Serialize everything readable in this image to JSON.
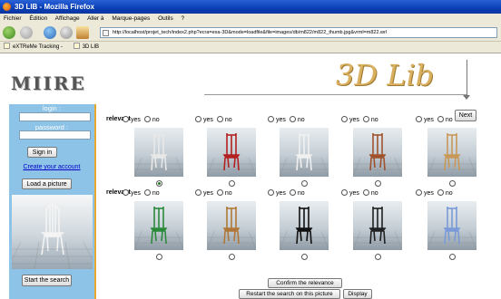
{
  "window": {
    "title": "3D LIB - Mozilla Firefox"
  },
  "menu": [
    "Fichier",
    "Édition",
    "Affichage",
    "Aller à",
    "Marque-pages",
    "Outils",
    "?"
  ],
  "address": {
    "url": "http://localhost/projet_tech/index2.php?ecra=exa-3D&mode=loadfile&file=images/db/m822/m822_thumb.jpg&vrml=m822.wrl"
  },
  "bookmarks": [
    "eXTReMe Tracking -",
    "3D LIB"
  ],
  "page": {
    "logo": "MIIRE",
    "brand": "3D Lib",
    "next_label": "Next",
    "relevant_label": "relevant",
    "yes_label": "yes",
    "no_label": "no",
    "confirm_label": "Confirm the relevance",
    "restart_label": "Restart the search on this picture",
    "display_label": "Display"
  },
  "sidebar": {
    "login_label": "login :",
    "password_label": "password :",
    "signin_label": "Sign in",
    "create_account": "Create your account",
    "load_picture": "Load a picture",
    "start_search": "Start the search"
  },
  "results": {
    "rows": [
      [
        {
          "object": "white-spindle-chair",
          "color": "#e8e8e8",
          "selected": true
        },
        {
          "object": "red-windsor-chair",
          "color": "#b22020",
          "selected": false
        },
        {
          "object": "white-slatted-chair",
          "color": "#f0f0f0",
          "selected": false
        },
        {
          "object": "wooden-chair",
          "color": "#a0522d",
          "selected": false
        },
        {
          "object": "ladderback-chair",
          "color": "#c89858",
          "selected": false
        }
      ],
      [
        {
          "object": "green-chair",
          "color": "#2a8a3a",
          "selected": false
        },
        {
          "object": "tall-wooden-chair",
          "color": "#b07838",
          "selected": false
        },
        {
          "object": "black-chair",
          "color": "#111111",
          "selected": false
        },
        {
          "object": "office-chair",
          "color": "#202020",
          "selected": false
        },
        {
          "object": "blue-figure",
          "color": "#7a9ad8",
          "selected": false
        }
      ]
    ]
  }
}
